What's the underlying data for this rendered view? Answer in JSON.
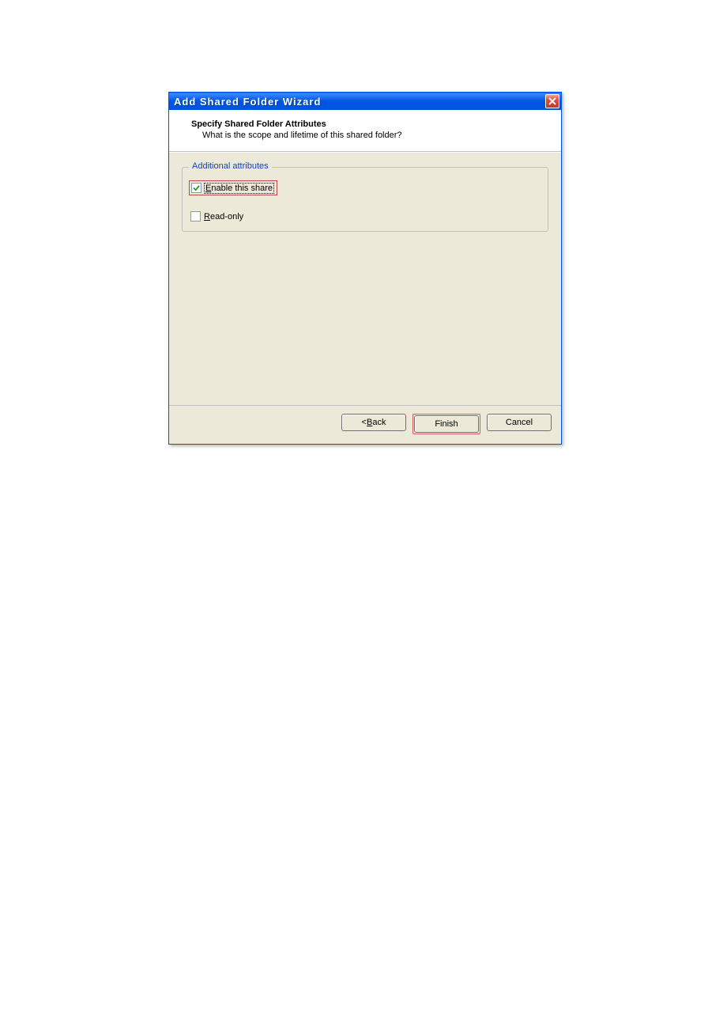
{
  "window": {
    "title": "Add Shared Folder Wizard"
  },
  "header": {
    "title": "Specify Shared Folder Attributes",
    "subtitle": "What is the scope and lifetime of this shared folder?"
  },
  "fieldset": {
    "legend": "Additional attributes",
    "enable_share": {
      "label_pre": "E",
      "label_post": "nable this share",
      "checked": true
    },
    "read_only": {
      "label_pre": "R",
      "label_post": "ead-only",
      "checked": false
    }
  },
  "buttons": {
    "back_pre": "< ",
    "back_underline": "B",
    "back_post": "ack",
    "finish": "Finish",
    "cancel": "Cancel"
  }
}
